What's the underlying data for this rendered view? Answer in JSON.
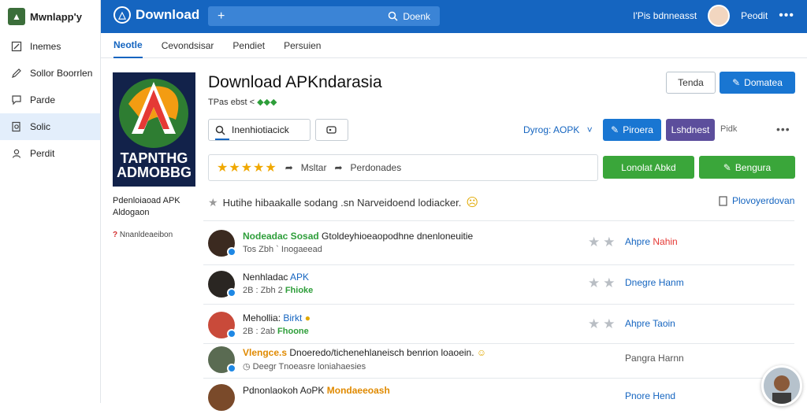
{
  "sidebar": {
    "brand": "Mwnlapp'y",
    "items": [
      {
        "label": "Inemes",
        "icon": "edit-box-icon"
      },
      {
        "label": "Sollor Boorrlen",
        "icon": "pencil-icon"
      },
      {
        "label": "Parde",
        "icon": "chat-icon"
      },
      {
        "label": "Solic",
        "icon": "search-doc-icon"
      },
      {
        "label": "Perdit",
        "icon": "user-icon"
      }
    ]
  },
  "header": {
    "title": "Download",
    "search_placeholder": "Doenk",
    "user_info": "I'Pis bdnneasst",
    "username": "Peodit"
  },
  "tabs": [
    "Neotle",
    "Cevondsisar",
    "Pendiet",
    "Persuien"
  ],
  "app": {
    "icon_text_1": "TAPNTHG",
    "icon_text_2": "ADMOBBG",
    "caption": "Pdenloiaoad APK Aldogaon",
    "sub_mark": "?",
    "sub_text": "Nnanldeaeibon",
    "heading": "Download APKndarasia",
    "info": "TPas ebst <",
    "info_green": "◆◆◆"
  },
  "actions": {
    "tenda": "Tenda",
    "domatea": "Domatea",
    "input_value": "Inenhiotiacick",
    "dropdown": "Dyrog: AOPK",
    "btn_blue": "Piroera",
    "btn_purple": "Lshdnest",
    "btn_text": "Pidk",
    "rating_label_1": "Msltar",
    "rating_label_2": "Perdonades",
    "green_1": "Lonolat Abkd",
    "green_2": "Bengura"
  },
  "notice": {
    "text": "Hutihe hibaakalle sodang .sn Narveidoend lodiacker.",
    "link": "Plovoyerdovan"
  },
  "reviews": [
    {
      "name": "Nodeadac Sosad",
      "text": "Gtoldeyhioeaopodhne dnenloneuitie",
      "meta": "Tos Zbh  ` Inogaeead",
      "link1": "Ahpre",
      "link2": "Nahin",
      "avatar": "#3b2a20"
    },
    {
      "name": "Nenhladac",
      "tag": "APK",
      "meta": "2B : Zbh 2",
      "meta_tag": "Fhioke",
      "link1": "Dnegre Hanm",
      "avatar": "#2a2622"
    },
    {
      "name": "Mehollia:",
      "tag": "Birkt",
      "meta": "2B : 2ab",
      "meta_tag": "Fhoone",
      "link1": "Ahpre Taoin",
      "avatar": "#c94a3a"
    },
    {
      "name": "Vlengce.s",
      "text": "Dnoeredo/tichenehlaneisch benrion loaoein.",
      "meta": "Deegr Tnoeasre loniahaesies",
      "link1": "Pangra Harnn",
      "avatar": "#5a6b52"
    },
    {
      "name": "Pdnonlaokoh AoPK",
      "tag": "Mondaeeoash",
      "link1": "Pnore Hend",
      "avatar": "#7a4a2a"
    }
  ]
}
